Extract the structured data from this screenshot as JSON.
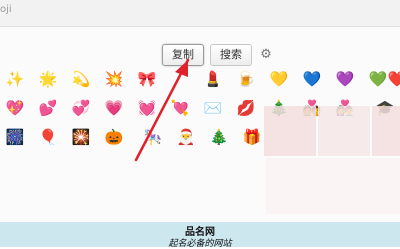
{
  "topbar": {
    "partial_text": "oji"
  },
  "toolbar": {
    "copy_label": "复制",
    "search_label": "搜索",
    "settings_icon": "gear-icon"
  },
  "emoji_rows": [
    [
      "✨",
      "🌟",
      "💫",
      "💥",
      "🎀",
      "💄",
      "🍺",
      "💛",
      "💙",
      "💜",
      "💚",
      "❤️"
    ],
    [
      "💖",
      "💕",
      "💞",
      "💗",
      "💓",
      "💘",
      "✉️",
      "💋",
      "🎄",
      "💑",
      "👩‍❤️‍👨",
      "🎓"
    ],
    [
      "🎆",
      "🎈",
      "🎇",
      "🎃",
      "🎠",
      "🎅",
      "🎄",
      "🎁"
    ]
  ],
  "footer": {
    "title": "品名网",
    "subtitle": "起名必备的网站"
  },
  "colors": {
    "footer_bg": "#cde7ef",
    "arrow": "#e0202a",
    "blur": "#f3dede"
  }
}
